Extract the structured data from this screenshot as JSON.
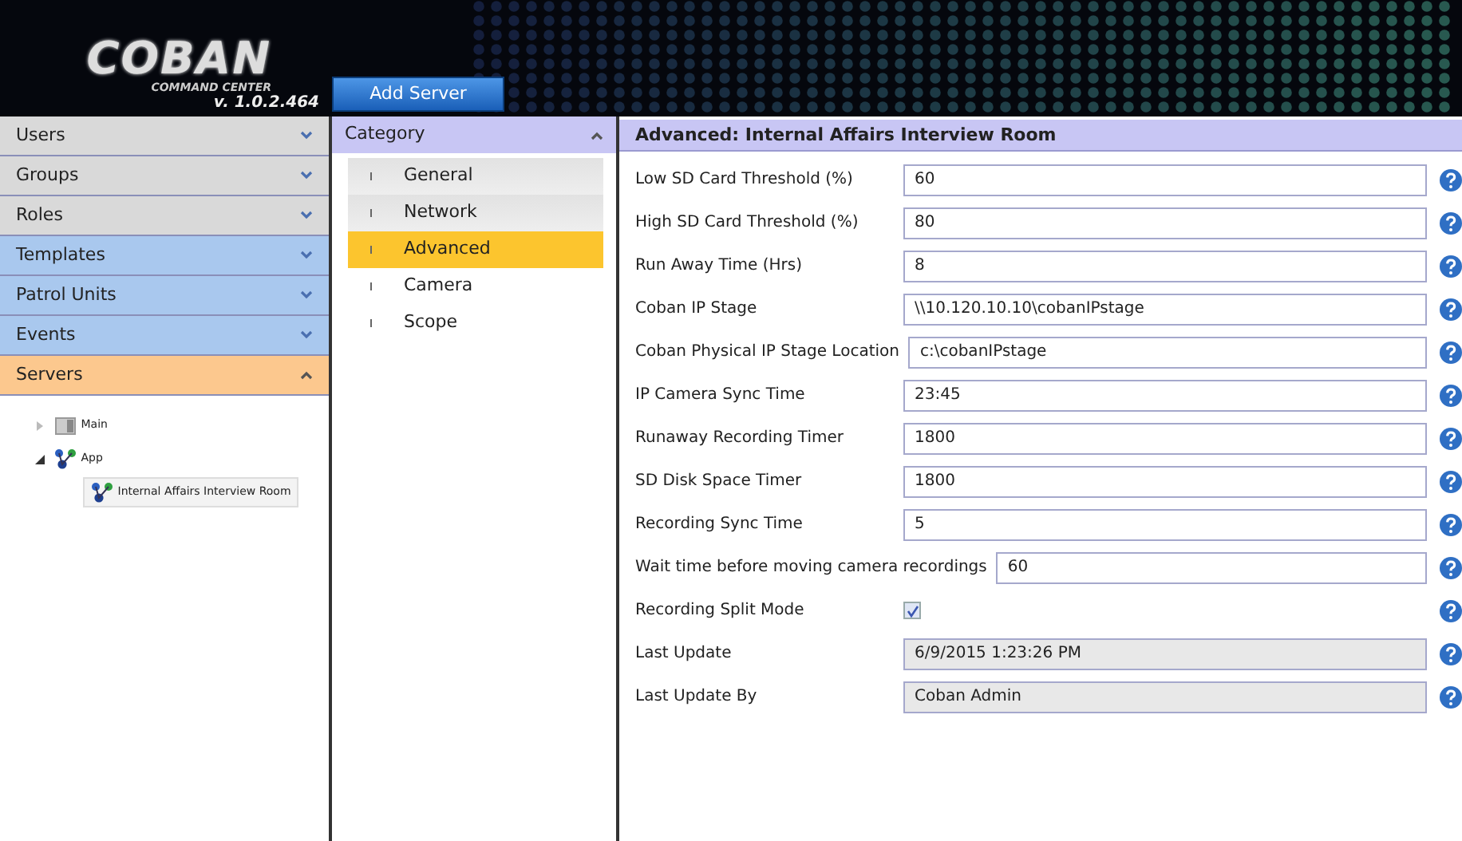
{
  "header": {
    "logo": "COBAN",
    "subtitle": "COMMAND CENTER",
    "version": "v. 1.0.2.464",
    "button": "Add Server"
  },
  "sidebar": {
    "sections": [
      {
        "label": "Users",
        "color": "#d9d9d9",
        "expanded": false
      },
      {
        "label": "Groups",
        "color": "#d9d9d9",
        "expanded": false
      },
      {
        "label": "Roles",
        "color": "#d9d9d9",
        "expanded": false
      },
      {
        "label": "Templates",
        "color": "#a9c8ee",
        "expanded": false
      },
      {
        "label": "Patrol Units",
        "color": "#a9c8ee",
        "expanded": false
      },
      {
        "label": "Events",
        "color": "#a9c8ee",
        "expanded": false
      },
      {
        "label": "Servers",
        "color": "#fcc88e",
        "expanded": true
      }
    ],
    "tree": [
      {
        "label": "Main",
        "kind": "server",
        "expanded": false,
        "selected": false
      },
      {
        "label": "App",
        "kind": "network",
        "expanded": true,
        "selected": false,
        "children": [
          {
            "label": "Internal Affairs Interview Room",
            "kind": "network",
            "selected": true
          }
        ]
      }
    ]
  },
  "category": {
    "title": "Category",
    "expanded": true,
    "items": [
      {
        "label": "General",
        "selected": false
      },
      {
        "label": "Network",
        "selected": false
      },
      {
        "label": "Advanced",
        "selected": true
      },
      {
        "label": "Camera",
        "selected": false
      },
      {
        "label": "Scope",
        "selected": false
      }
    ]
  },
  "form": {
    "title": "Advanced: Internal Affairs Interview Room",
    "fields": [
      {
        "label": "Low SD Card Threshold (%)",
        "kind": "text",
        "value": "60",
        "disabled": false
      },
      {
        "label": "High SD Card Threshold (%)",
        "kind": "text",
        "value": "80",
        "disabled": false
      },
      {
        "label": "Run Away Time (Hrs)",
        "kind": "text",
        "value": "8",
        "disabled": false
      },
      {
        "label": "Coban IP Stage",
        "kind": "text",
        "value": "\\\\10.120.10.10\\cobanIPstage",
        "disabled": false
      },
      {
        "label": "Coban Physical IP Stage Location",
        "kind": "text",
        "value": "c:\\cobanIPstage",
        "disabled": false
      },
      {
        "label": "IP Camera Sync Time",
        "kind": "text",
        "value": "23:45",
        "disabled": false
      },
      {
        "label": "Runaway Recording Timer",
        "kind": "text",
        "value": "1800",
        "disabled": false
      },
      {
        "label": "SD Disk Space Timer",
        "kind": "text",
        "value": "1800",
        "disabled": false
      },
      {
        "label": "Recording Sync Time",
        "kind": "text",
        "value": "5",
        "disabled": false
      },
      {
        "label": "Wait time before moving camera recordings",
        "kind": "text",
        "value": "60",
        "disabled": false
      },
      {
        "label": "Recording Split Mode",
        "kind": "checkbox",
        "checked": true
      },
      {
        "label": "Last Update",
        "kind": "text",
        "value": "6/9/2015 1:23:26 PM",
        "disabled": true
      },
      {
        "label": "Last Update By",
        "kind": "text",
        "value": "Coban Admin",
        "disabled": true
      }
    ]
  }
}
